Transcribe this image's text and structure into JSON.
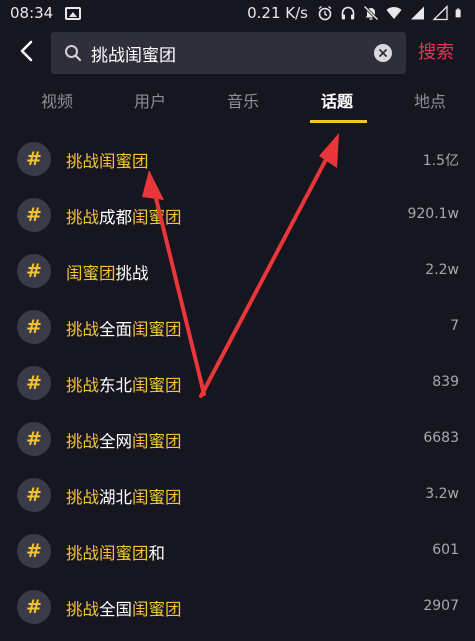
{
  "status_bar": {
    "time": "08:34",
    "speed": "0.21 K/s"
  },
  "search": {
    "back_icon": "chevron-left-icon",
    "search_icon": "magnifier-icon",
    "query": "挑战闺蜜团",
    "clear_icon": "clear-circle-icon",
    "submit_label": "搜索",
    "submit_color": "#f0325a"
  },
  "tabs": [
    {
      "label": "视频",
      "active": false
    },
    {
      "label": "用户",
      "active": false
    },
    {
      "label": "音乐",
      "active": false
    },
    {
      "label": "话题",
      "active": true
    },
    {
      "label": "地点",
      "active": false
    }
  ],
  "topics": [
    {
      "hash": "#",
      "parts": [
        "挑战闺蜜团",
        ""
      ],
      "count": "1.5亿"
    },
    {
      "hash": "#",
      "parts": [
        "挑战",
        "成都",
        "闺蜜团"
      ],
      "count": "920.1w"
    },
    {
      "hash": "#",
      "parts": [
        "闺蜜团",
        "挑战",
        ""
      ],
      "count": "2.2w"
    },
    {
      "hash": "#",
      "parts": [
        "挑战",
        "全面",
        "闺蜜团"
      ],
      "count": "7"
    },
    {
      "hash": "#",
      "parts": [
        "挑战",
        "东北",
        "闺蜜团"
      ],
      "count": "839"
    },
    {
      "hash": "#",
      "parts": [
        "挑战",
        "全网",
        "闺蜜团"
      ],
      "count": "6683"
    },
    {
      "hash": "#",
      "parts": [
        "挑战",
        "湖北",
        "闺蜜团"
      ],
      "count": "3.2w"
    },
    {
      "hash": "#",
      "parts": [
        "挑战闺蜜团",
        "和",
        ""
      ],
      "count": "601"
    },
    {
      "hash": "#",
      "parts": [
        "挑战",
        "全国",
        "闺蜜团"
      ],
      "count": "2907"
    }
  ],
  "colors": {
    "background": "#15161f",
    "highlight": "#f4c430",
    "annotation_arrow": "#e8363b"
  }
}
